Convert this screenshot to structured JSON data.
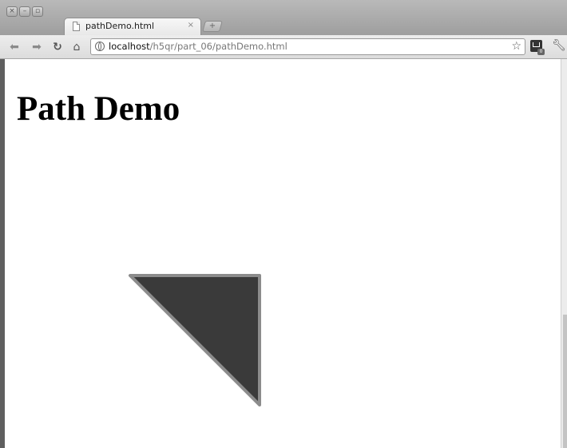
{
  "browser": {
    "tab": {
      "title": "pathDemo.html",
      "close_glyph": "×"
    },
    "newtab_glyph": "+",
    "omnibox": {
      "host": "localhost",
      "path": "/h5qr/part_06/pathDemo.html"
    },
    "ext_badge": "0"
  },
  "page": {
    "heading": "Path Demo",
    "shape": {
      "fill": "#3a3a3a",
      "stroke": "#8c8c8c"
    }
  },
  "icons": [
    "close-window-icon",
    "minimize-icon",
    "maximize-icon",
    "page-icon",
    "back-icon",
    "forward-icon",
    "reload-icon",
    "home-icon",
    "globe-icon",
    "star-icon",
    "extension-icon",
    "wrench-icon"
  ]
}
